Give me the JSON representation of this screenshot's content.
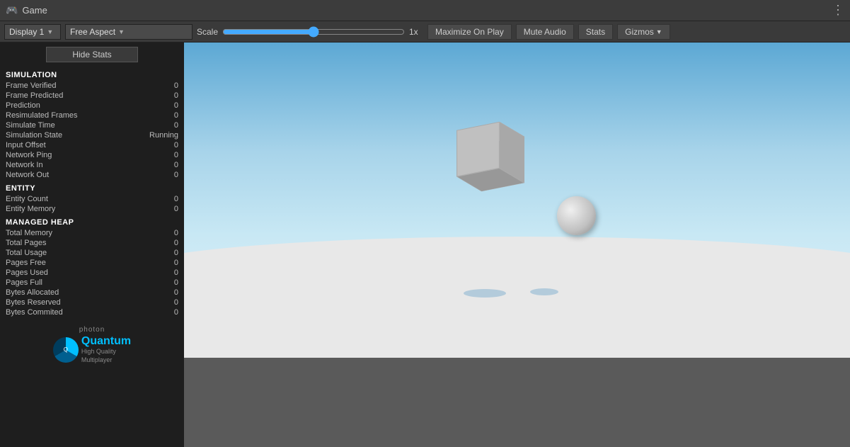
{
  "titleBar": {
    "gameLabel": "Game",
    "moreLabel": "⋮"
  },
  "toolbar": {
    "displayLabel": "Display 1",
    "aspectLabel": "Free Aspect",
    "scaleLabel": "Scale",
    "scaleValue": "1x",
    "maximizeLabel": "Maximize On Play",
    "muteLabel": "Mute Audio",
    "statsLabel": "Stats",
    "gizmosLabel": "Gizmos"
  },
  "stats": {
    "hideStatsLabel": "Hide Stats",
    "sections": [
      {
        "title": "SIMULATION",
        "rows": [
          {
            "name": "Frame Verified",
            "value": "0"
          },
          {
            "name": "Frame Predicted",
            "value": "0"
          },
          {
            "name": "Prediction",
            "value": "0"
          },
          {
            "name": "Resimulated Frames",
            "value": "0"
          },
          {
            "name": "Simulate Time",
            "value": "0"
          },
          {
            "name": "Simulation State",
            "value": "Running"
          },
          {
            "name": "Input Offset",
            "value": "0"
          },
          {
            "name": "Network Ping",
            "value": "0"
          },
          {
            "name": "Network In",
            "value": "0"
          },
          {
            "name": "Network Out",
            "value": "0"
          }
        ]
      },
      {
        "title": "ENTITY",
        "rows": [
          {
            "name": "Entity Count",
            "value": "0"
          },
          {
            "name": "Entity Memory",
            "value": "0"
          }
        ]
      },
      {
        "title": "MANAGED HEAP",
        "rows": [
          {
            "name": "Total Memory",
            "value": "0"
          },
          {
            "name": "Total Pages",
            "value": "0"
          },
          {
            "name": "Total Usage",
            "value": "0"
          },
          {
            "name": "Pages Free",
            "value": "0"
          },
          {
            "name": "Pages Used",
            "value": "0"
          },
          {
            "name": "Pages Full",
            "value": "0"
          },
          {
            "name": "Bytes Allocated",
            "value": "0"
          },
          {
            "name": "Bytes Reserved",
            "value": "0"
          },
          {
            "name": "Bytes Commited",
            "value": "0"
          }
        ]
      }
    ],
    "logo": {
      "photonText": "photon",
      "quantumTitle": "Quantum",
      "quantumSub1": "High Quality",
      "quantumSub2": "Multiplayer"
    }
  }
}
